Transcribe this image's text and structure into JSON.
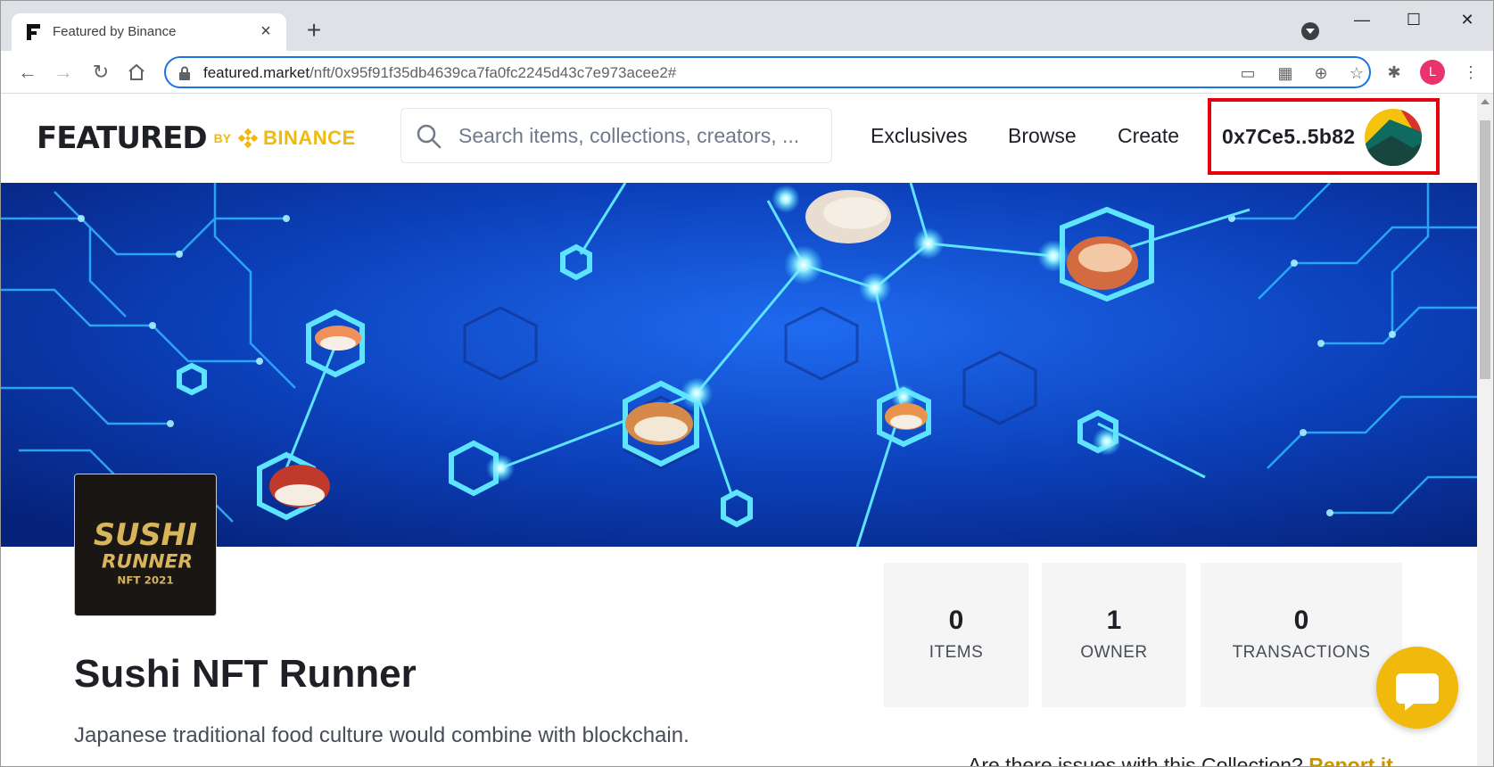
{
  "browser": {
    "tab_title": "Featured by Binance",
    "new_tab_symbol": "+",
    "url_domain": "featured.market",
    "url_path": "/nft/0x95f91f35db4639ca7fa0fc2245d43c7e973acee2#",
    "profile_initial": "L"
  },
  "header": {
    "logo_main": "FEATURED",
    "logo_by": "BY",
    "logo_binance": "BINANCE",
    "search_placeholder": "Search items, collections, creators, ...",
    "nav": [
      "Exclusives",
      "Browse",
      "Create"
    ],
    "wallet_address": "0x7Ce5..5b82"
  },
  "collection": {
    "logo_line1": "SUSHI",
    "logo_line2": "RUNNER",
    "logo_line3": "NFT 2021",
    "title": "Sushi NFT Runner",
    "description": "Japanese traditional food culture would combine with blockchain.",
    "stats": [
      {
        "value": "0",
        "label": "ITEMS"
      },
      {
        "value": "1",
        "label": "OWNER"
      },
      {
        "value": "0",
        "label": "TRANSACTIONS"
      }
    ],
    "report_text": "Are there issues with this Collection?",
    "report_link": "Report it"
  },
  "colors": {
    "brand_yellow": "#f0b90b",
    "highlight_red": "#e5000b",
    "banner_blue": "#0b3fb8"
  }
}
